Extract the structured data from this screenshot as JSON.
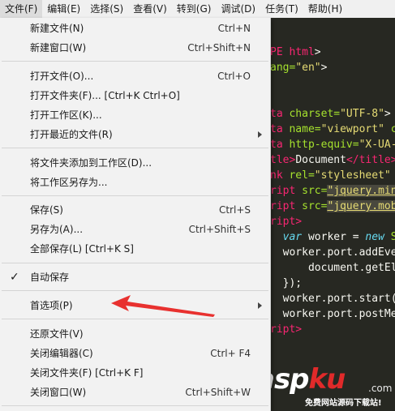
{
  "menubar": {
    "items": [
      "文件(F)",
      "编辑(E)",
      "选择(S)",
      "查看(V)",
      "转到(G)",
      "调试(D)",
      "任务(T)",
      "帮助(H)"
    ]
  },
  "file_menu": {
    "items": [
      {
        "label": "新建文件(N)",
        "shortcut": "Ctrl+N"
      },
      {
        "label": "新建窗口(W)",
        "shortcut": "Ctrl+Shift+N"
      },
      {
        "label": "打开文件(O)...",
        "shortcut": "Ctrl+O"
      },
      {
        "label": "打开文件夹(F)... [Ctrl+K Ctrl+O]",
        "shortcut": ""
      },
      {
        "label": "打开工作区(K)...",
        "shortcut": ""
      },
      {
        "label": "打开最近的文件(R)",
        "shortcut": ""
      },
      {
        "label": "将文件夹添加到工作区(D)...",
        "shortcut": ""
      },
      {
        "label": "将工作区另存为...",
        "shortcut": ""
      },
      {
        "label": "保存(S)",
        "shortcut": "Ctrl+S"
      },
      {
        "label": "另存为(A)...",
        "shortcut": "Ctrl+Shift+S"
      },
      {
        "label": "全部保存(L) [Ctrl+K S]",
        "shortcut": ""
      },
      {
        "label": "自动保存",
        "shortcut": ""
      },
      {
        "label": "首选项(P)",
        "shortcut": ""
      },
      {
        "label": "还原文件(V)",
        "shortcut": ""
      },
      {
        "label": "关闭编辑器(C)",
        "shortcut": "Ctrl+ F4"
      },
      {
        "label": "关闭文件夹(F) [Ctrl+K F]",
        "shortcut": ""
      },
      {
        "label": "关闭窗口(W)",
        "shortcut": "Ctrl+Shift+W"
      }
    ],
    "check_glyph": "✓"
  },
  "editor": {
    "lines": [
      [
        "PE html",
        ">"
      ],
      [
        "ang=",
        "\"en\"",
        ">"
      ],
      [
        "",
        "",
        ""
      ],
      [
        "ta ",
        "charset=",
        "\"UTF-8\"",
        ">"
      ],
      [
        "ta ",
        "name=",
        "\"viewport\"",
        " co"
      ],
      [
        "ta ",
        "http-equiv=",
        "\"X-UA-C"
      ],
      [
        "tle>",
        "Document",
        "</title>"
      ],
      [
        "nk ",
        "rel=",
        "\"stylesheet\"",
        " h"
      ],
      [
        "ript ",
        "src=",
        "\"jquery.min."
      ],
      [
        "ript ",
        "src=",
        "\"jquery.mobi"
      ],
      [
        "ript>"
      ],
      [
        "var",
        " worker = ",
        "new",
        " Sha"
      ],
      [
        "worker.port.addEvent"
      ],
      [
        "    document.getEler"
      ],
      [
        "});"
      ],
      [
        "worker.port.start();"
      ],
      [
        "worker.port.postMess"
      ],
      [
        "ript>"
      ]
    ]
  },
  "watermark": {
    "logo_left": "asp",
    "logo_right": "ku",
    "domain": ".com",
    "tagline": "免费网站源码下载站!"
  },
  "colors": {
    "menu_bg": "#f2f2f2",
    "editor_bg": "#272822",
    "annotation": "#e8312f"
  }
}
